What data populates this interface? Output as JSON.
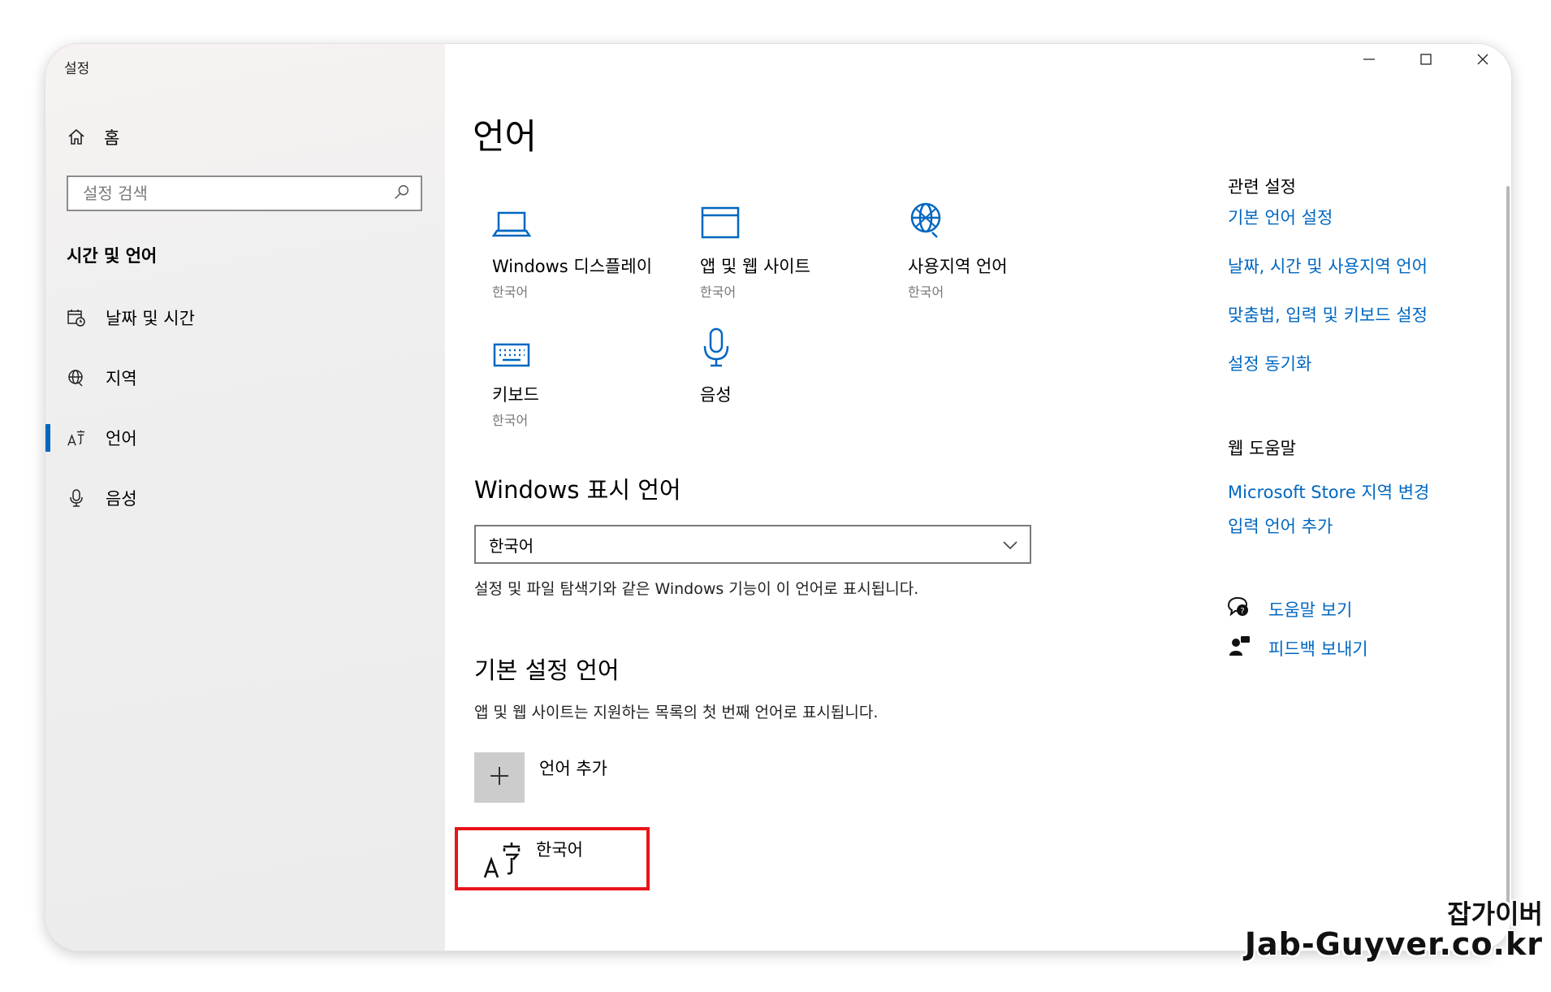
{
  "window": {
    "title": "설정"
  },
  "sidebar": {
    "home_label": "홈",
    "search_placeholder": "설정 검색",
    "section_title": "시간 및 언어",
    "items": [
      {
        "label": "날짜 및 시간",
        "icon": "calendar-clock-icon"
      },
      {
        "label": "지역",
        "icon": "globe-icon"
      },
      {
        "label": "언어",
        "icon": "language-icon",
        "active": true
      },
      {
        "label": "음성",
        "icon": "microphone-icon"
      }
    ]
  },
  "main": {
    "title": "언어",
    "tiles": [
      {
        "label": "Windows 디스플레이",
        "sub": "한국어",
        "icon": "laptop-icon"
      },
      {
        "label": "앱 및 웹 사이트",
        "sub": "한국어",
        "icon": "app-window-icon"
      },
      {
        "label": "사용지역 언어",
        "sub": "한국어",
        "icon": "globe-icon"
      },
      {
        "label": "키보드",
        "sub": "한국어",
        "icon": "keyboard-icon"
      },
      {
        "label": "음성",
        "sub": "",
        "icon": "microphone-icon"
      }
    ],
    "display_language": {
      "heading": "Windows 표시 언어",
      "selected": "한국어",
      "description": "설정 및 파일 탐색기와 같은 Windows 기능이 이 언어로 표시됩니다."
    },
    "preferred": {
      "heading": "기본 설정 언어",
      "description": "앱 및 웹 사이트는 지원하는 목록의 첫 번째 언어로 표시됩니다.",
      "add_label": "언어 추가",
      "languages": [
        "한국어"
      ]
    }
  },
  "related": {
    "heading": "관련 설정",
    "links": [
      "기본 언어 설정",
      "날짜, 시간 및 사용지역 언어",
      "맞춤법, 입력 및 키보드 설정",
      "설정 동기화"
    ],
    "web_help_heading": "웹 도움말",
    "web_links": [
      "Microsoft Store 지역 변경",
      "입력 언어 추가"
    ],
    "help_link": "도움말 보기",
    "feedback_link": "피드백 보내기"
  },
  "watermark": {
    "line1": "잡가이버",
    "line2": "Jab-Guyver.co.kr"
  },
  "colors": {
    "accent": "#0067c0",
    "highlight": "#e8141b",
    "sidebar_bg": "#ececec"
  }
}
